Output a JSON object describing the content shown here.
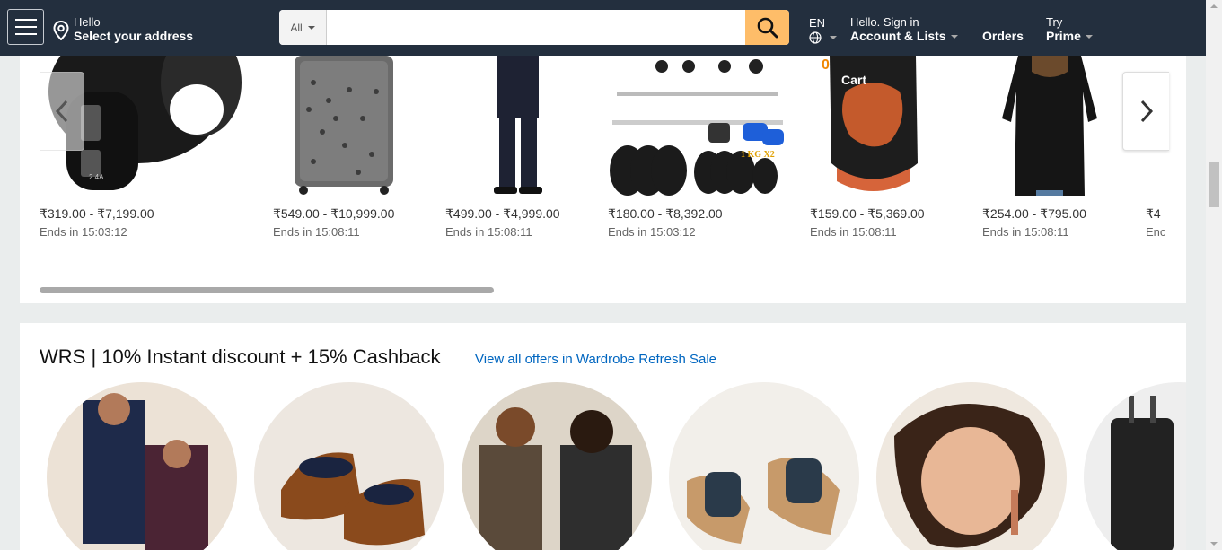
{
  "header": {
    "location": {
      "hello": "Hello",
      "select": "Select your address"
    },
    "search": {
      "category": "All",
      "placeholder": ""
    },
    "lang": "EN",
    "account": {
      "hello": "Hello. Sign in",
      "label": "Account & Lists"
    },
    "orders": "Orders",
    "prime": {
      "try": "Try",
      "label": "Prime"
    },
    "cart": {
      "count": "0",
      "label": "Cart"
    }
  },
  "deals": [
    {
      "name": "car-charger",
      "price": "₹319.00 - ₹7,199.00",
      "ends": "Ends in 15:03:12"
    },
    {
      "name": "suitcase",
      "price": "₹549.00 - ₹10,999.00",
      "ends": "Ends in 15:08:11"
    },
    {
      "name": "suit",
      "price": "₹499.00 - ₹4,999.00",
      "ends": "Ends in 15:08:11"
    },
    {
      "name": "gym-set",
      "price": "₹180.00 - ₹8,392.00",
      "ends": "Ends in 15:03:12"
    },
    {
      "name": "backpack",
      "price": "₹159.00 - ₹5,369.00",
      "ends": "Ends in 15:08:11"
    },
    {
      "name": "top",
      "price": "₹254.00 - ₹795.00",
      "ends": "Ends in 15:08:11"
    },
    {
      "name": "partial",
      "price": "₹4",
      "ends": "Enc"
    }
  ],
  "wrs": {
    "title": "WRS | 10% Instant discount + 15% Cashback",
    "link": "View all offers in Wardrobe Refresh Sale"
  },
  "colors": {
    "header_bg": "#232f3e",
    "search_button": "#febd69",
    "cart_count": "#f08804",
    "link": "#0066c0"
  },
  "icons": [
    "menu-icon",
    "location-pin-icon",
    "search-icon",
    "globe-icon",
    "chevron-left-icon",
    "chevron-right-icon"
  ]
}
